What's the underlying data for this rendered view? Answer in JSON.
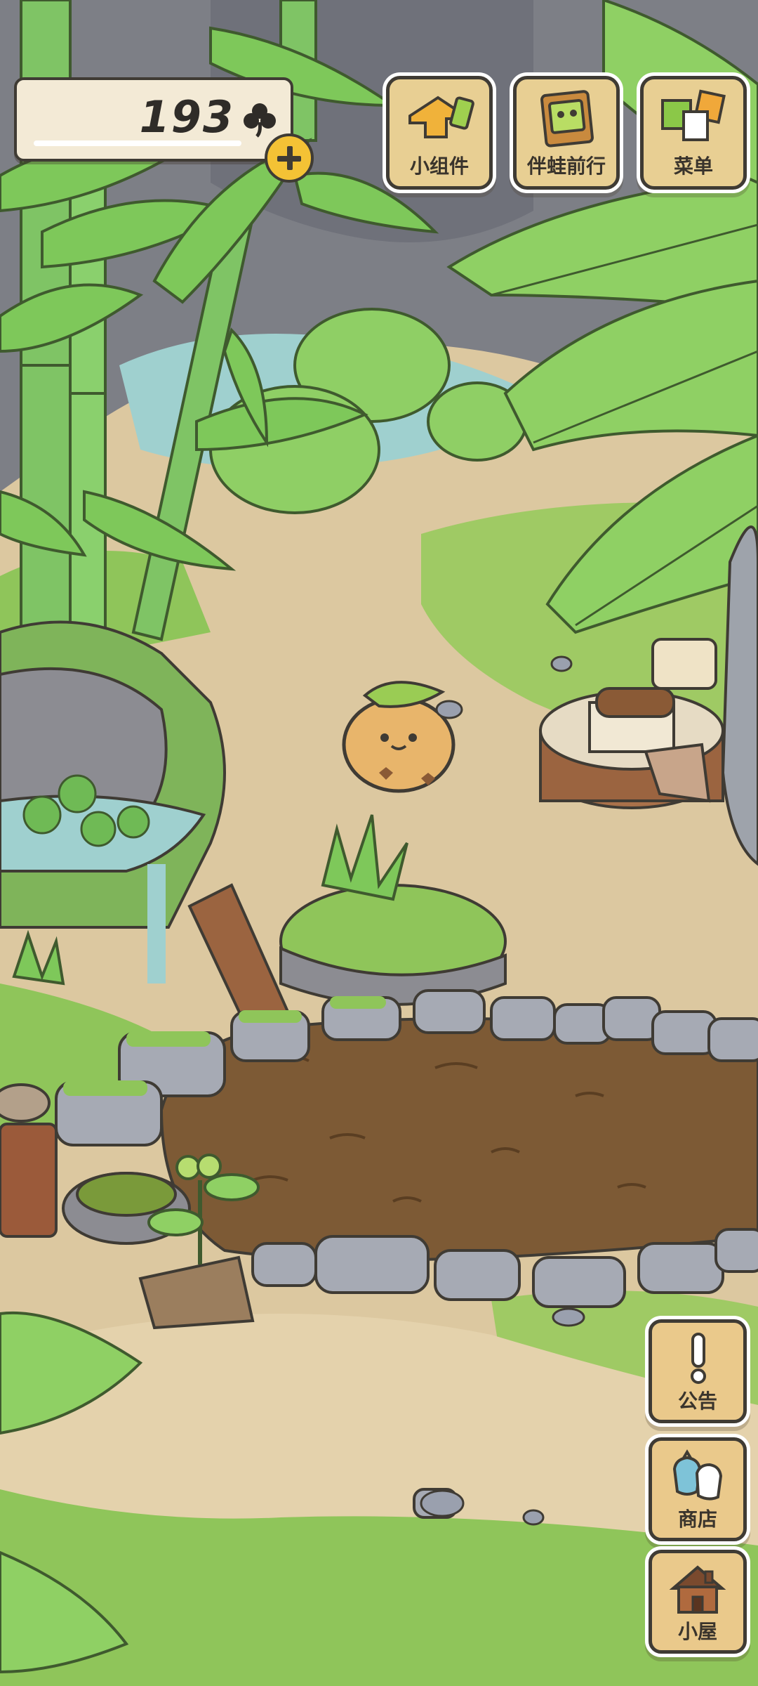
{
  "currency": {
    "amount": "193",
    "icon": "clover-icon"
  },
  "top_buttons": {
    "widgets": {
      "label": "小组件",
      "icon": "widget-pieces-icon"
    },
    "travel": {
      "label": "伴蛙前行",
      "icon": "frog-card-icon"
    },
    "menu": {
      "label": "菜单",
      "icon": "menu-cards-icon"
    }
  },
  "side_buttons": {
    "notice": {
      "label": "公告",
      "icon": "exclamation-icon"
    },
    "shop": {
      "label": "商店",
      "icon": "shop-bags-icon"
    },
    "house": {
      "label": "小屋",
      "icon": "house-icon"
    }
  },
  "colors": {
    "accent": "#f4c235",
    "button_wood": "#e8cf93",
    "outline": "#3f3b34",
    "soil": "#7d5a35",
    "grass": "#8fc55a"
  }
}
